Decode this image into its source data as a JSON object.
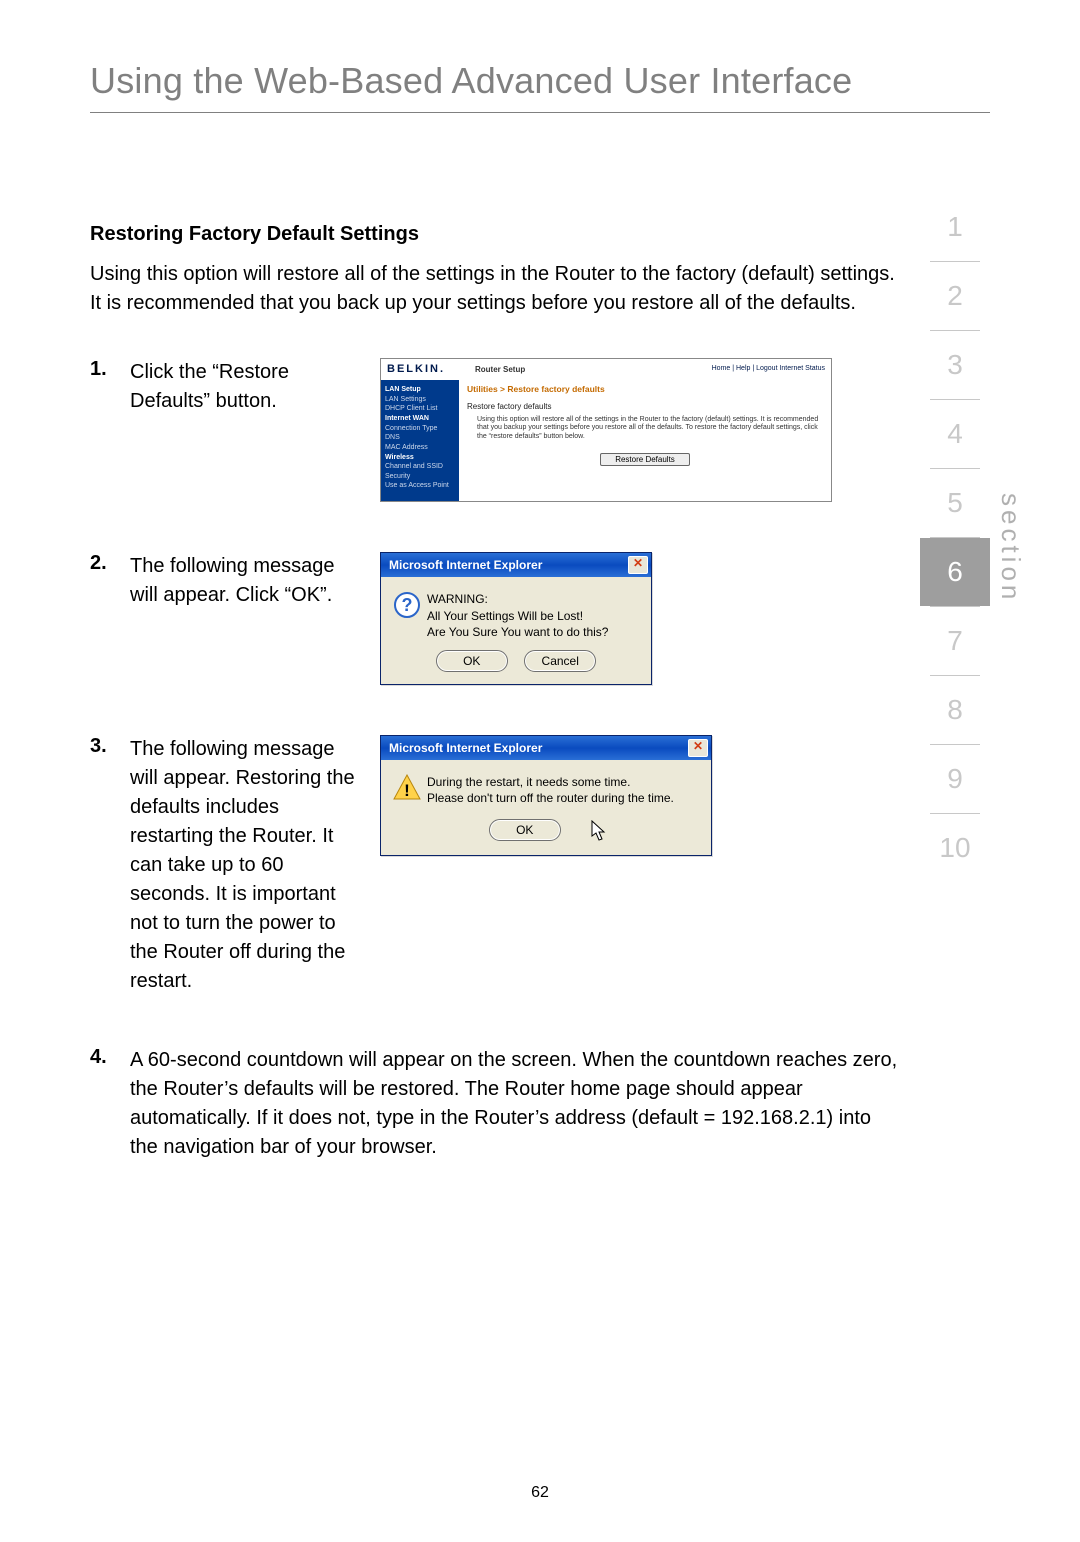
{
  "chapter_title": "Using the Web-Based Advanced User Interface",
  "section_heading": "Restoring Factory Default Settings",
  "intro": "Using this option will restore all of the settings in the Router to the factory (default) settings. It is recommended that you back up your settings before you restore all of the defaults.",
  "steps": {
    "s1": "Click the “Restore Defaults” button.",
    "s2": "The following message will appear. Click “OK”.",
    "s3": "The following message will appear. Restoring the defaults includes restarting the Router. It can take up to 60 seconds. It is important not to turn the power to the Router off during the restart.",
    "s4": "A 60-second countdown will appear on the screen. When the countdown reaches zero, the Router’s defaults will be restored. The Router home page should appear automatically. If it does not, type in the Router’s address (default = 192.168.2.1) into the navigation bar of your browser."
  },
  "router_ui": {
    "brand": "BELKIN.",
    "subtitle": "Router Setup",
    "top_links": "Home | Help | Logout   Internet Status",
    "sidebar": {
      "cat1": "LAN Setup",
      "i1": "LAN Settings",
      "i2": "DHCP Client List",
      "cat2": "Internet WAN",
      "i3": "Connection Type",
      "i4": "DNS",
      "i5": "MAC Address",
      "cat3": "Wireless",
      "i6": "Channel and SSID",
      "i7": "Security",
      "i8": "Use as Access Point"
    },
    "breadcrumb": "Utilities > Restore factory defaults",
    "desc_title": "Restore factory defaults",
    "desc": "Using this option will restore all of the settings in the Router to the factory (default) settings. It is recommended that you backup your settings before you restore all of the defaults. To restore the factory default settings, click the “restore defaults” button below.",
    "button": "Restore Defaults"
  },
  "dialog1": {
    "title": "Microsoft Internet Explorer",
    "line1": "WARNING:",
    "line2": "All Your Settings Will be Lost!",
    "line3": "Are You Sure You want to do this?",
    "ok": "OK",
    "cancel": "Cancel"
  },
  "dialog2": {
    "title": "Microsoft Internet Explorer",
    "line1": "During the restart, it needs some time.",
    "line2": "Please don't turn off the router during the time.",
    "ok": "OK"
  },
  "section_label": "section",
  "section_numbers": [
    "1",
    "2",
    "3",
    "4",
    "5",
    "6",
    "7",
    "8",
    "9",
    "10"
  ],
  "active_section_index": 5,
  "page_number": "62"
}
